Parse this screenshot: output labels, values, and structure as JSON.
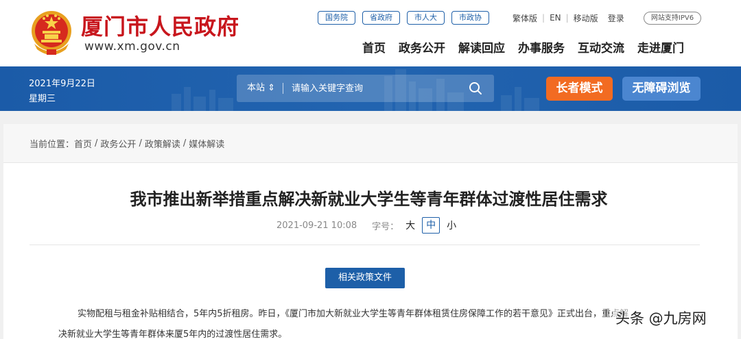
{
  "header": {
    "site_title": "厦门市人民政府",
    "site_url": "www.xm.gov.cn",
    "top_links": [
      "国务院",
      "省政府",
      "市人大",
      "市政协"
    ],
    "util_links": {
      "traditional": "繁体版",
      "english": "EN",
      "mobile": "移动版",
      "login": "登录",
      "ipv6": "网站支持IPV6"
    },
    "nav": [
      "首页",
      "政务公开",
      "解读回应",
      "办事服务",
      "互动交流",
      "走进厦门"
    ]
  },
  "banner": {
    "date": "2021年9月22日",
    "weekday": "星期三",
    "search_scope": "本站 ⇕",
    "search_placeholder": "请输入关键字查询",
    "elder_mode": "长者模式",
    "accessible": "无障碍浏览"
  },
  "breadcrumb": {
    "prefix": "当前位置：",
    "items": [
      "首页",
      "政务公开",
      "政策解读",
      "媒体解读"
    ]
  },
  "article": {
    "title": "我市推出新举措重点解决新就业大学生等青年群体过渡性居住需求",
    "datetime": "2021-09-21 10:08",
    "font_size_label": "字号：",
    "font_sizes": [
      "大",
      "中",
      "小"
    ],
    "active_font_size": "中",
    "policy_button": "相关政策文件",
    "paragraph_1": "实物配租与租金补贴相结合，5年内5折租房。昨日，《厦门市加大新就业大学生等青年群体租赁住房保障工作的若干意见》正式出台，重点解",
    "paragraph_2": "决新就业大学生等青年群体来厦5年内的过渡性居住需求。"
  },
  "watermark": "头条 @九房网",
  "colors": {
    "brand_red": "#c8161d",
    "gov_blue": "#1d5fa8",
    "elder_orange": "#f26b22",
    "access_blue": "#4b86d0"
  }
}
